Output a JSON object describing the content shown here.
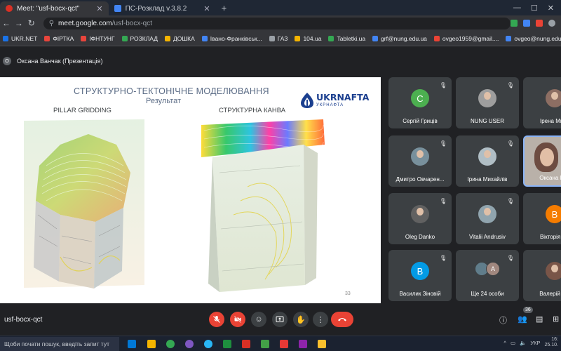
{
  "tabs": [
    {
      "title": "Meet: \"usf-bocx-qct\"",
      "active": true
    },
    {
      "title": "ПС-Розклад v.3.8.2",
      "active": false
    }
  ],
  "address": {
    "url_host": "meet.google.com",
    "url_path": "/usf-bocx-qct"
  },
  "bookmarks": [
    {
      "label": "UKR.NET",
      "color": "#1a73e8"
    },
    {
      "label": "ФІРТКА",
      "color": "#e8453c"
    },
    {
      "label": "ІФНТУНГ",
      "color": "#e8453c"
    },
    {
      "label": "РОЗКЛАД",
      "color": "#34a853"
    },
    {
      "label": "ДОШКА",
      "color": "#f4b400"
    },
    {
      "label": "Івано-Франківськ...",
      "color": "#4285f4"
    },
    {
      "label": "ГАЗ",
      "color": "#9aa0a6"
    },
    {
      "label": "104.ua",
      "color": "#f4b400"
    },
    {
      "label": "Tabletki.ua",
      "color": "#34a853"
    },
    {
      "label": "grf@nung.edu.ua",
      "color": "#4285f4"
    },
    {
      "label": "ovgeo1959@gmail....",
      "color": "#ea4335"
    },
    {
      "label": "ovgeo@nung.edu.ua",
      "color": "#4285f4"
    }
  ],
  "presenter": {
    "initial": "О",
    "label": "Оксана Ванчак (Презентація)"
  },
  "slide": {
    "title": "СТРУКТУРНО-ТЕКТОНІЧНЕ МОДЕЛЮВАННЯ",
    "subtitle": "Результат",
    "left_label": "PILLAR GRIDDING",
    "right_label": "СТРУКТУРНА КАНВА",
    "logo_brand": "UKRNAFTA",
    "logo_sub": "УКРНАФТА",
    "page_number": "33"
  },
  "participants": [
    {
      "name": "Сергій Гриців",
      "initial": "С",
      "color": "#4caf50",
      "kind": "letter"
    },
    {
      "name": "NUNG USER",
      "initial": "",
      "color": "#9e9e9e",
      "kind": "photo"
    },
    {
      "name": "Ірена Мисл",
      "initial": "",
      "color": "#8d6e63",
      "kind": "photo"
    },
    {
      "name": "Дмитро Овчарен...",
      "initial": "",
      "color": "#78909c",
      "kind": "photo"
    },
    {
      "name": "Ірина Михайлів",
      "initial": "",
      "color": "#b0bec5",
      "kind": "photo"
    },
    {
      "name": "Оксана Ван",
      "initial": "",
      "color": "#6d4c41",
      "kind": "video"
    },
    {
      "name": "Oleg Danko",
      "initial": "",
      "color": "#616161",
      "kind": "photo"
    },
    {
      "name": "Vitalii Andrusiv",
      "initial": "",
      "color": "#90a4ae",
      "kind": "photo"
    },
    {
      "name": "Вікторія Тю",
      "initial": "В",
      "color": "#f57c00",
      "kind": "letter"
    },
    {
      "name": "Василик Зіновій",
      "initial": "В",
      "color": "#039be5",
      "kind": "letter"
    },
    {
      "name": "Ще 24 особи",
      "initial": "A",
      "color": "#a1887f",
      "kind": "group"
    },
    {
      "name": "Валерій Ом",
      "initial": "",
      "color": "#795548",
      "kind": "photo"
    }
  ],
  "meeting_code": "usf-bocx-qct",
  "people_count": "36",
  "taskbar": {
    "search_placeholder": "Щоби почати пошук, введіть запит тут",
    "lang": "УКР",
    "time": "16:",
    "date": "25.10."
  }
}
